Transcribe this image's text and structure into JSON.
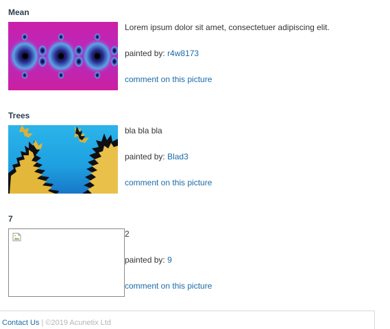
{
  "pictures": [
    {
      "title": "Mean",
      "description": "Lorem ipsum dolor sit amet, consectetuer adipiscing elit.",
      "painted_by_label": "painted by:",
      "painter": "r4w8173",
      "comment_link": "comment on this picture",
      "image": "mandelbrot-fractal-magenta"
    },
    {
      "title": "Trees",
      "description": "bla bla bla",
      "painted_by_label": "painted by:",
      "painter": "Blad3",
      "comment_link": "comment on this picture",
      "image": "fractal-blue-yellow"
    },
    {
      "title": "7",
      "description": "2",
      "painted_by_label": "painted by:",
      "painter": "9",
      "comment_link": "comment on this picture",
      "image": "broken-image-icon"
    }
  ],
  "footer": {
    "contact_link": "Contact Us",
    "separator": "|",
    "copyright": "©2019 Acunetix Ltd"
  },
  "colors": {
    "link": "#1a6aa6",
    "title": "#2b3e50",
    "text": "#333333",
    "muted": "#b5b5b5"
  }
}
